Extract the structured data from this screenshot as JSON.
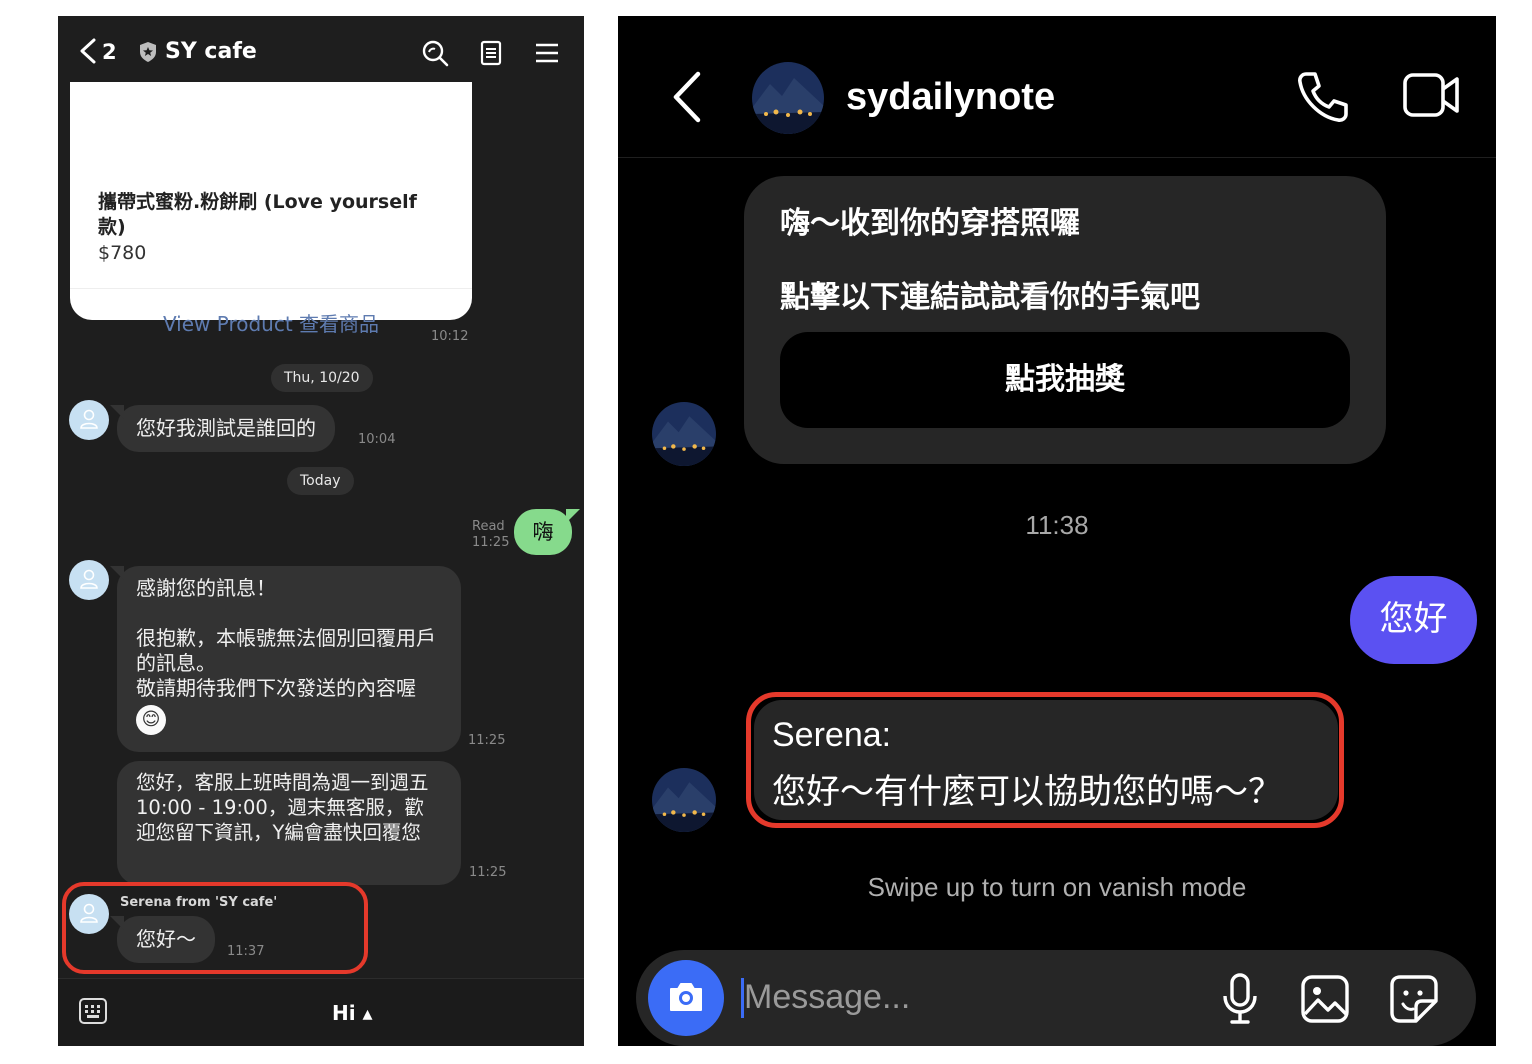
{
  "line": {
    "header": {
      "back_count": "2",
      "title": "SY cafe"
    },
    "product": {
      "name": "攜帶式蜜粉.粉餅刷 (Love yourself 款)",
      "price": "$780",
      "link": "View Product 查看商品",
      "time": "10:12"
    },
    "date1": "Thu, 10/20",
    "msg1": {
      "text": "您好我測試是誰回的",
      "time": "10:04"
    },
    "date2": "Today",
    "sent": {
      "text": "嗨",
      "read": "Read",
      "time": "11:25"
    },
    "msg2": {
      "line1": "感謝您的訊息！",
      "line2": "很抱歉，本帳號無法個別回覆用戶的訊息。",
      "line3": "敬請期待我們下次發送的內容喔",
      "emoji": "😊",
      "time": "11:25"
    },
    "msg3": {
      "text": "您好，客服上班時間為週一到週五10:00 - 19:00，週末無客服，歡迎您留下資訊，Y編會盡快回覆您",
      "time": "11:25"
    },
    "msg4": {
      "sender": "Serena from 'SY cafe'",
      "text": "您好～",
      "time": "11:37"
    },
    "footer": {
      "label": "Hi ▴"
    }
  },
  "instagram": {
    "username": "sydailynote",
    "card": {
      "line1": "嗨～收到你的穿搭照囉",
      "line2": "點擊以下連結試試看你的手氣吧",
      "button": "點我抽獎"
    },
    "time": "11:38",
    "sent": "您好",
    "reply": {
      "name": "Serena:",
      "text": "您好～有什麼可以協助您的嗎～？"
    },
    "vanish": "Swipe up to turn on vanish mode",
    "composer": {
      "placeholder": "Message..."
    }
  },
  "colors": {
    "line_green": "#86da8c",
    "ig_purple": "#5b51f2",
    "ig_camera": "#3b6cf6",
    "highlight_red": "#e5392b"
  }
}
